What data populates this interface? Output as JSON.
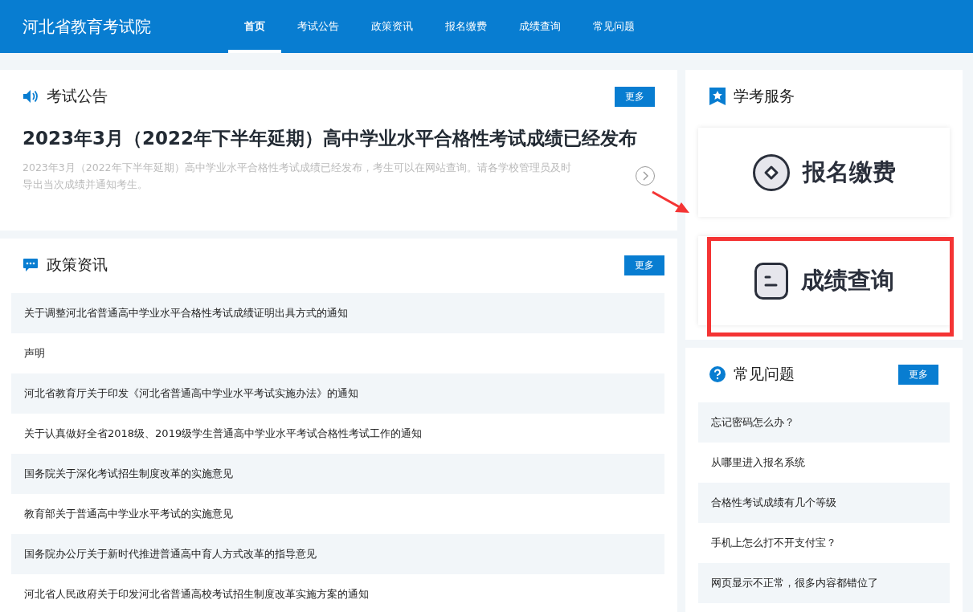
{
  "header": {
    "site_title": "河北省教育考试院",
    "nav": [
      {
        "label": "首页",
        "selected": true
      },
      {
        "label": "考试公告",
        "selected": false
      },
      {
        "label": "政策资讯",
        "selected": false
      },
      {
        "label": "报名缴费",
        "selected": false
      },
      {
        "label": "成绩查询",
        "selected": false
      },
      {
        "label": "常见问题",
        "selected": false
      }
    ]
  },
  "announcements": {
    "title": "考试公告",
    "more": "更多",
    "headline": "2023年3月（2022年下半年延期）高中学业水平合格性考试成绩已经发布",
    "summary": "2023年3月（2022年下半年延期）高中学业水平合格性考试成绩已经发布，考生可以在网站查询。请各学校管理员及时导出当次成绩并通知考生。"
  },
  "policy": {
    "title": "政策资讯",
    "more": "更多",
    "items": [
      "关于调整河北省普通高中学业水平合格性考试成绩证明出具方式的通知",
      "声明",
      "河北省教育厅关于印发《河北省普通高中学业水平考试实施办法》的通知",
      "关于认真做好全省2018级、2019级学生普通高中学业水平考试合格性考试工作的通知",
      "国务院关于深化考试招生制度改革的实施意见",
      "教育部关于普通高中学业水平考试的实施意见",
      "国务院办公厅关于新时代推进普通高中育人方式改革的指导意见",
      "河北省人民政府关于印发河北省普通高校考试招生制度改革实施方案的通知"
    ]
  },
  "services": {
    "title": "学考服务",
    "items": [
      {
        "label": "报名缴费",
        "kind": "coin",
        "highlighted": false
      },
      {
        "label": "成绩查询",
        "kind": "document",
        "highlighted": true
      }
    ]
  },
  "faq": {
    "title": "常见问题",
    "more": "更多",
    "items": [
      "忘记密码怎么办？",
      "从哪里进入报名系统",
      "合格性考试成绩有几个等级",
      "手机上怎么打不开支付宝？",
      "网页显示不正常，很多内容都错位了"
    ]
  }
}
